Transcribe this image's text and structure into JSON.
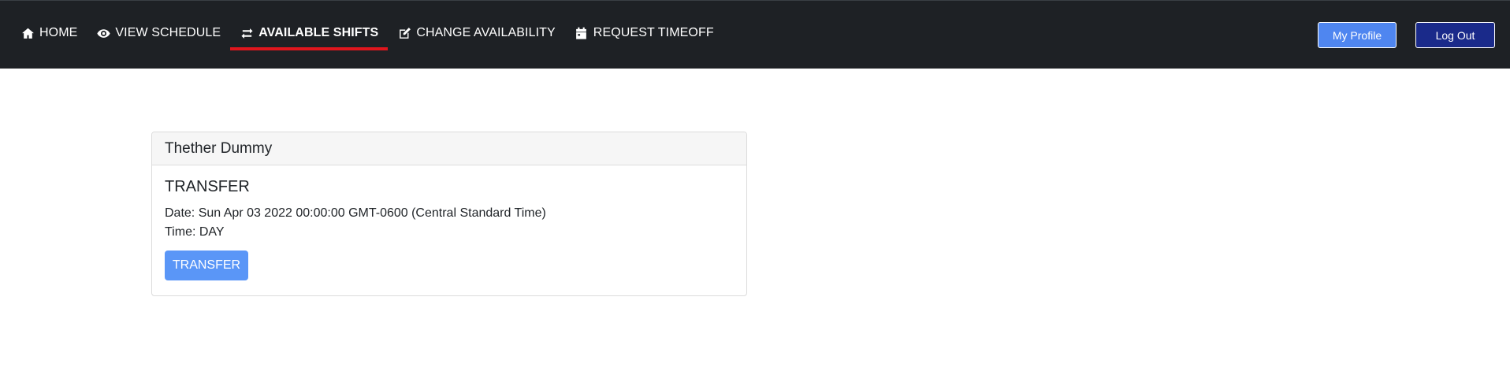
{
  "nav": {
    "items": [
      {
        "label": "HOME",
        "icon": "home-icon"
      },
      {
        "label": "VIEW SCHEDULE",
        "icon": "eye-icon"
      },
      {
        "label": "AVAILABLE SHIFTS",
        "icon": "swap-icon",
        "active": true
      },
      {
        "label": "CHANGE AVAILABILITY",
        "icon": "edit-icon"
      },
      {
        "label": "REQUEST TIMEOFF",
        "icon": "calendar-icon"
      }
    ],
    "profile_label": "My Profile",
    "logout_label": "Log Out",
    "active_underline_color": "#e0161d"
  },
  "shift_card": {
    "employee_name": "Thether Dummy",
    "title": "TRANSFER",
    "date_line": "Date: Sun Apr 03 2022 00:00:00 GMT-0600 (Central Standard Time)",
    "time_line": "Time: DAY",
    "button_label": "TRANSFER"
  }
}
